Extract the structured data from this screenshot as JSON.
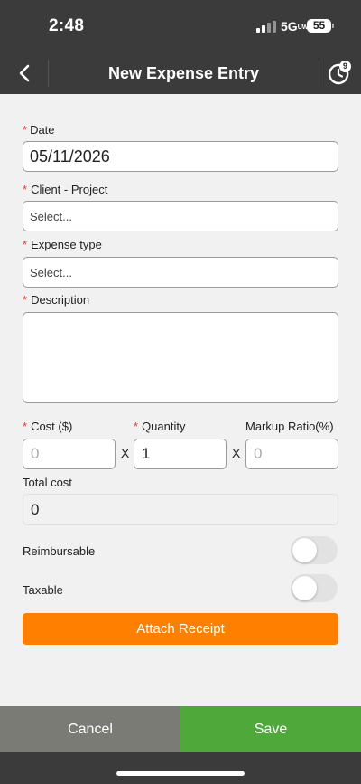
{
  "status_bar": {
    "time": "2:48",
    "network": "5G",
    "network_suffix": "UW",
    "battery": "55"
  },
  "nav": {
    "title": "New Expense Entry",
    "back_icon": "chevron-left-icon",
    "history_icon": "history-icon",
    "history_badge": "9"
  },
  "form": {
    "required_marker": "*",
    "date": {
      "label": "Date",
      "value": "05/11/2026"
    },
    "client_project": {
      "label": "Client - Project",
      "placeholder": "Select..."
    },
    "expense_type": {
      "label": "Expense type",
      "placeholder": "Select..."
    },
    "description": {
      "label": "Description",
      "value": ""
    },
    "cost": {
      "label": "Cost ($)",
      "placeholder": "0",
      "value": ""
    },
    "quantity": {
      "label": "Quantity",
      "value": "1"
    },
    "markup_ratio": {
      "label": "Markup Ratio(%)",
      "placeholder": "0",
      "value": ""
    },
    "multiply_sign": "X",
    "total_cost": {
      "label": "Total cost",
      "value": "0"
    },
    "reimbursable": {
      "label": "Reimbursable",
      "on": false
    },
    "taxable": {
      "label": "Taxable",
      "on": false
    },
    "attach_receipt_label": "Attach Receipt"
  },
  "footer": {
    "cancel_label": "Cancel",
    "save_label": "Save"
  },
  "colors": {
    "header_bg": "#3b3b3b",
    "page_bg": "#f1f1f1",
    "required": "#e53935",
    "attach": "#ff8000",
    "cancel": "#7b7b76",
    "save": "#4fa93a"
  }
}
